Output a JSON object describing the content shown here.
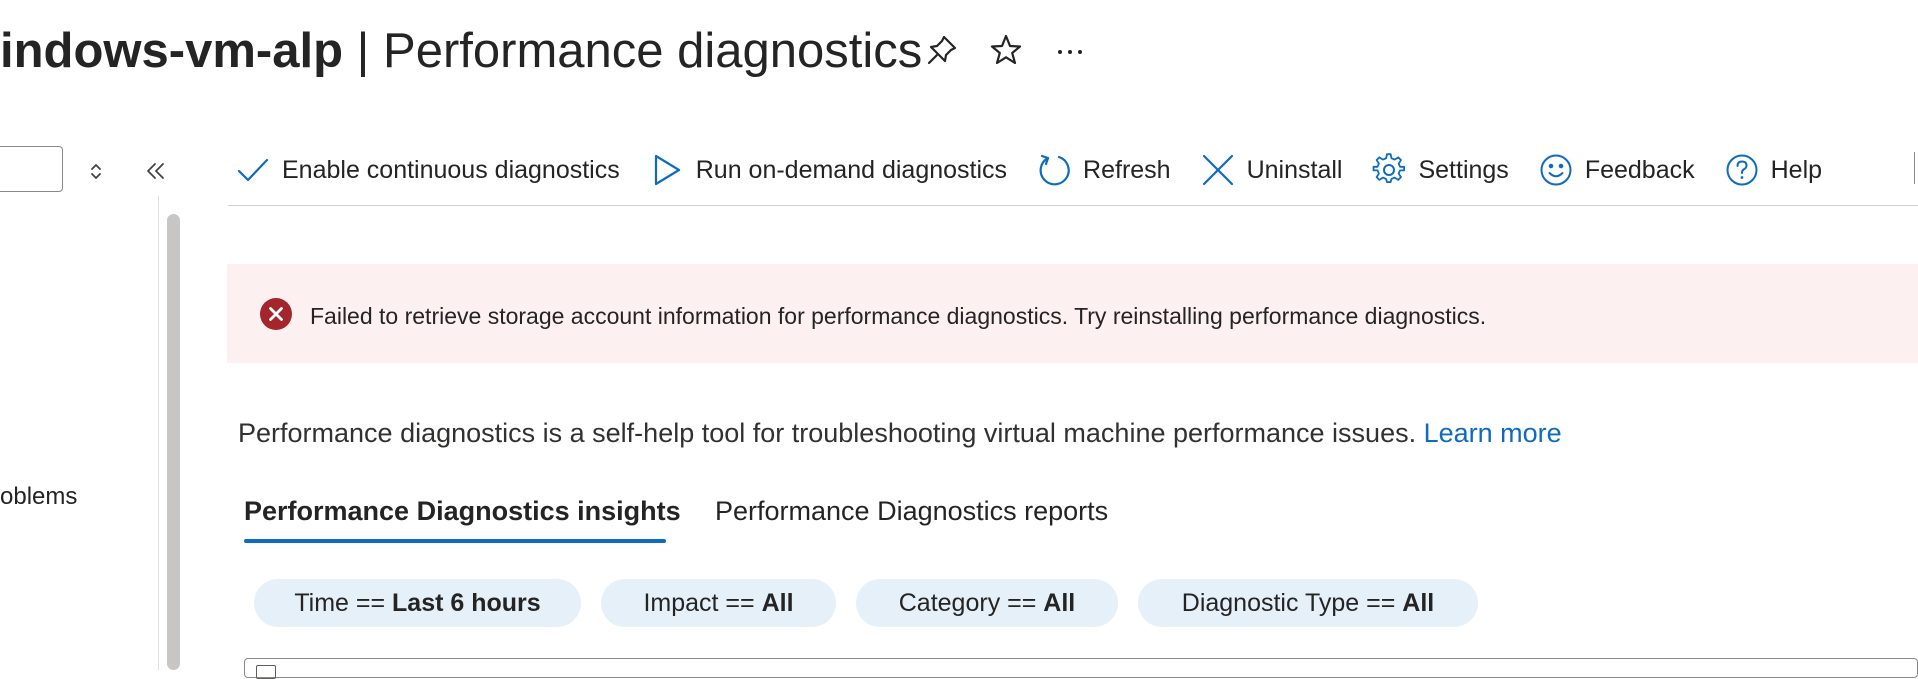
{
  "header": {
    "vm_name": "indows-vm-alp",
    "separator": "|",
    "page_name": "Performance diagnostics",
    "icons": [
      "pin-icon",
      "star-icon",
      "more-icon"
    ]
  },
  "sidebar": {
    "partial_item_label": "oblems",
    "icons": [
      "expand-collapse-icon",
      "collapse-sidebar-icon"
    ]
  },
  "toolbar": {
    "enable_continuous": "Enable continuous diagnostics",
    "run_on_demand": "Run on-demand diagnostics",
    "refresh": "Refresh",
    "uninstall": "Uninstall",
    "settings": "Settings",
    "feedback": "Feedback",
    "help": "Help"
  },
  "error": {
    "message": "Failed to retrieve storage account information for performance diagnostics. Try reinstalling performance diagnostics.",
    "color": "#a4262c"
  },
  "intro": {
    "text": "Performance diagnostics is a self-help tool for troubleshooting virtual machine performance issues. ",
    "link": "Learn more"
  },
  "tabs": [
    {
      "label": "Performance Diagnostics insights",
      "active": true
    },
    {
      "label": "Performance Diagnostics reports",
      "active": false
    }
  ],
  "filters": [
    {
      "key": "Time == ",
      "value": "Last 6 hours"
    },
    {
      "key": "Impact == ",
      "value": "All"
    },
    {
      "key": "Category == ",
      "value": "All"
    },
    {
      "key": "Diagnostic Type == ",
      "value": "All"
    }
  ],
  "colors": {
    "accent": "#0f6cbd",
    "error_background": "#fdf0f0",
    "filter_pill": "#e6f0f9"
  }
}
